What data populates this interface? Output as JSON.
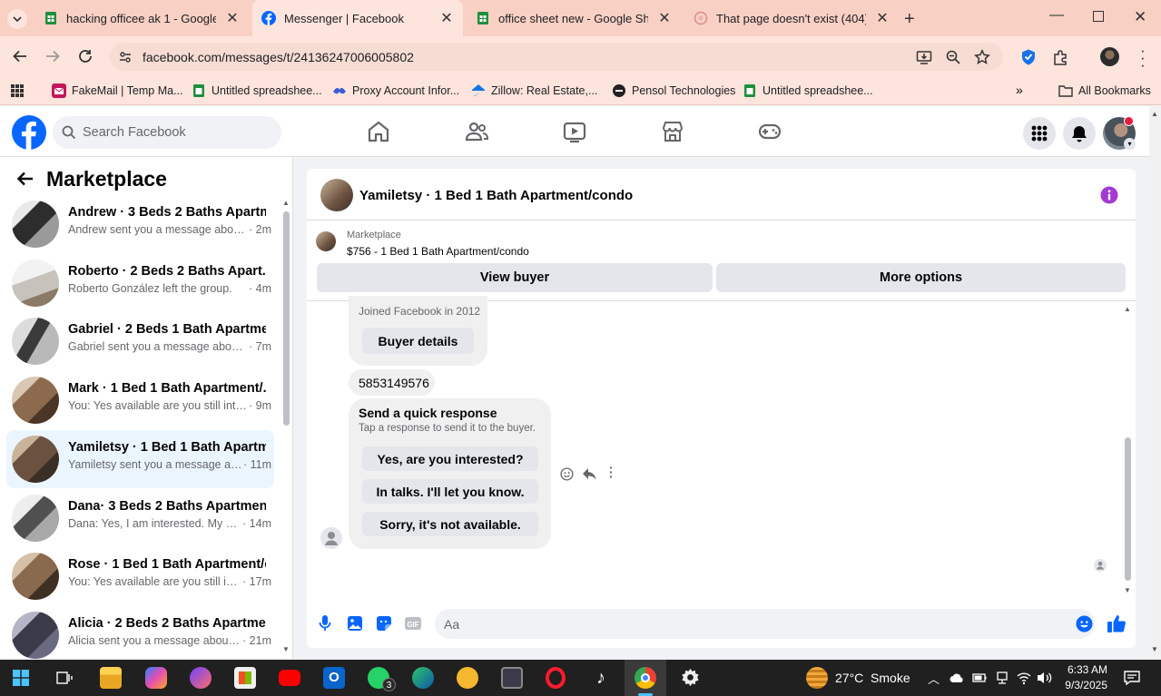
{
  "browser": {
    "tabs": [
      {
        "title": "hacking officee ak 1 - Google Sheets",
        "icon": "sheets-icon",
        "active": false
      },
      {
        "title": "Messenger | Facebook",
        "icon": "facebook-icon",
        "active": true
      },
      {
        "title": "office sheet new - Google Sheets",
        "icon": "sheets-icon",
        "active": false
      },
      {
        "title": "That page doesn't exist (404) - F",
        "icon": "page-icon",
        "active": false
      }
    ],
    "url": "facebook.com/messages/t/24136247006005802",
    "bookmarks": [
      {
        "label": "FakeMail | Temp Ma...",
        "icon": "fakemail-icon"
      },
      {
        "label": "Untitled spreadshee...",
        "icon": "sheets-icon"
      },
      {
        "label": "Proxy Account Infor...",
        "icon": "proxy-icon"
      },
      {
        "label": "Zillow: Real Estate,...",
        "icon": "zillow-icon"
      },
      {
        "label": "Pensol Technologies",
        "icon": "pensol-icon"
      },
      {
        "label": "Untitled spreadshee...",
        "icon": "sheets-icon"
      }
    ],
    "all_bookmarks": "All Bookmarks"
  },
  "facebook": {
    "search_placeholder": "Search Facebook"
  },
  "sidebar": {
    "title": "Marketplace",
    "conversations": [
      {
        "name": "Andrew · 3 Beds 2 Baths Apartm...",
        "preview": "Andrew sent you a message about...",
        "time": " · 2m",
        "selected": false
      },
      {
        "name": "Roberto · 2 Beds 2 Baths Apart...",
        "preview": "Roberto González left the group.",
        "time": " · 4m",
        "selected": false
      },
      {
        "name": "Gabriel · 2 Beds 1 Bath Apartme...",
        "preview": "Gabriel sent you a message about ...",
        "time": " · 7m",
        "selected": false
      },
      {
        "name": "Mark · 1 Bed 1 Bath Apartment/...",
        "preview": "You: Yes available are you still inter...",
        "time": " · 9m",
        "selected": false
      },
      {
        "name": "Yamiletsy · 1 Bed 1 Bath Apartm...",
        "preview": "Yamiletsy sent you a message ab...",
        "time": " · 11m",
        "selected": true
      },
      {
        "name": "Dana· 3 Beds 2 Baths Apartmen...",
        "preview": "Dana: Yes, I am interested. My nu...",
        "time": " · 14m",
        "selected": false
      },
      {
        "name": "Rose · 1 Bed 1 Bath Apartment/c...",
        "preview": "You: Yes available are you still int...",
        "time": " · 17m",
        "selected": false
      },
      {
        "name": "Alicia · 2 Beds 2 Baths Apartme...",
        "preview": "Alicia sent you a message about ...",
        "time": " · 21m",
        "selected": false
      }
    ]
  },
  "chat": {
    "title": "Yamiletsy · 1 Bed 1 Bath Apartment/condo",
    "listing_label": "Marketplace",
    "listing_desc": "$756 - 1 Bed 1 Bath Apartment/condo",
    "view_buyer": "View buyer",
    "more_options": "More options",
    "joined": "Joined Facebook in 2012",
    "buyer_details": "Buyer details",
    "phone": "5853149576",
    "quick_title": "Send a quick response",
    "quick_sub": "Tap a response to send it to the buyer.",
    "quick_responses": [
      "Yes, are you interested?",
      "In talks. I'll let you know.",
      "Sorry, it's not available."
    ],
    "composer_placeholder": "Aa"
  },
  "taskbar": {
    "weather": "27°C  Smoke",
    "time": "6:33 AM",
    "date": "9/3/2025",
    "whatsapp_badge": "3"
  },
  "colors": {
    "accent": "#0866ff",
    "chrome_tab_bg": "#f9d0c4",
    "chrome_toolbar": "#fde4dc",
    "selected_conv": "#ebf5ff",
    "info_purple": "#a33bd1"
  }
}
